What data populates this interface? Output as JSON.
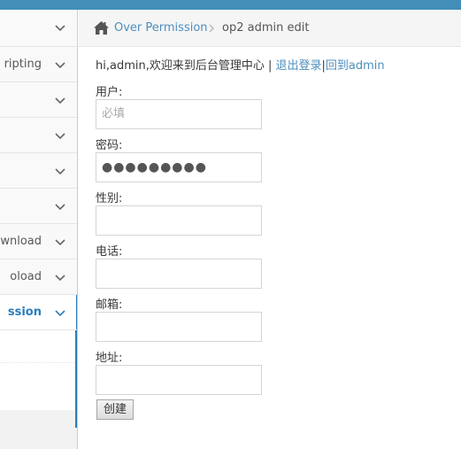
{
  "sidebar": {
    "items": [
      {
        "label": ""
      },
      {
        "label": "ripting"
      },
      {
        "label": ""
      },
      {
        "label": ""
      },
      {
        "label": ""
      },
      {
        "label": ""
      },
      {
        "label": "ownload"
      },
      {
        "label": "oload"
      },
      {
        "label": "ssion",
        "active": true
      }
    ],
    "active_color": "#2b7dbc"
  },
  "breadcrumb": {
    "home_icon": "home-icon",
    "link": "Over Permission",
    "current": "op2 admin edit"
  },
  "welcome": {
    "text": "hi,admin,欢迎来到后台管理中心 | ",
    "logout": "退出登录",
    "separator": "|",
    "back": "回到admin"
  },
  "form": {
    "username_label": "用户:",
    "username_placeholder": "必填",
    "password_label": "密码:",
    "password_value": "●●●●●●●●●",
    "gender_label": "性别:",
    "phone_label": "电话:",
    "email_label": "邮箱:",
    "address_label": "地址:",
    "submit_label": "创建"
  },
  "colors": {
    "topbar": "#438eb9",
    "link": "#4c8fbd"
  }
}
